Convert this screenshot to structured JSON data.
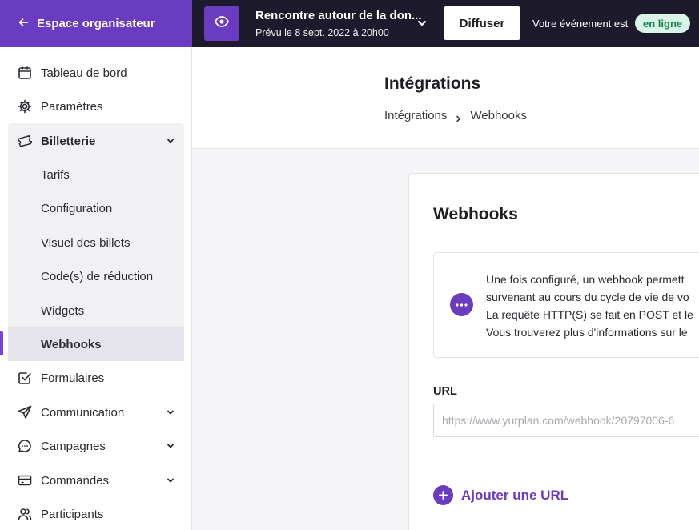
{
  "topbar": {
    "org_link": "Espace organisateur",
    "event_title": "Rencontre autour de la don...",
    "event_date": "Prévu le 8 sept. 2022 à 20h00",
    "publish_label": "Diffuser",
    "status_text": "Votre événement est",
    "status_badge": "en ligne",
    "icons": {
      "back": "arrow-left-icon",
      "preview": "eye-icon",
      "event_menu": "chevron-down-icon"
    }
  },
  "sidebar": {
    "items": [
      {
        "label": "Tableau de bord",
        "icon": "calendar-icon"
      },
      {
        "label": "Paramètres",
        "icon": "gear-icon"
      },
      {
        "label": "Billetterie",
        "icon": "ticket-icon",
        "expanded": true,
        "children": [
          "Tarifs",
          "Configuration",
          "Visuel des billets",
          "Code(s) de réduction",
          "Widgets",
          "Webhooks"
        ]
      },
      {
        "label": "Formulaires",
        "icon": "checkbox-icon"
      },
      {
        "label": "Communication",
        "icon": "send-icon"
      },
      {
        "label": "Campagnes",
        "icon": "chat-bubble-icon"
      },
      {
        "label": "Commandes",
        "icon": "credit-card-icon"
      },
      {
        "label": "Participants",
        "icon": "users-icon"
      }
    ],
    "active_child": "Webhooks"
  },
  "header": {
    "title": "Intégrations",
    "breadcrumb": [
      "Intégrations",
      "Webhooks"
    ]
  },
  "card": {
    "title": "Webhooks",
    "info_lines": [
      "Une fois configuré, un webhook permett",
      "survenant au cours du cycle de vie de vo",
      "La requête HTTP(S) se fait en POST et le",
      "Vous trouverez plus d'informations sur le"
    ],
    "url_label": "URL",
    "url_placeholder": "https://www.yurplan.com/webhook/20797006-6",
    "add_url_label": "Ajouter une URL"
  },
  "colors": {
    "accent": "#6a3cc2",
    "topbar_bg": "#1c1a2b",
    "status_badge_bg": "#d9f5e7",
    "status_badge_text": "#17804d"
  }
}
